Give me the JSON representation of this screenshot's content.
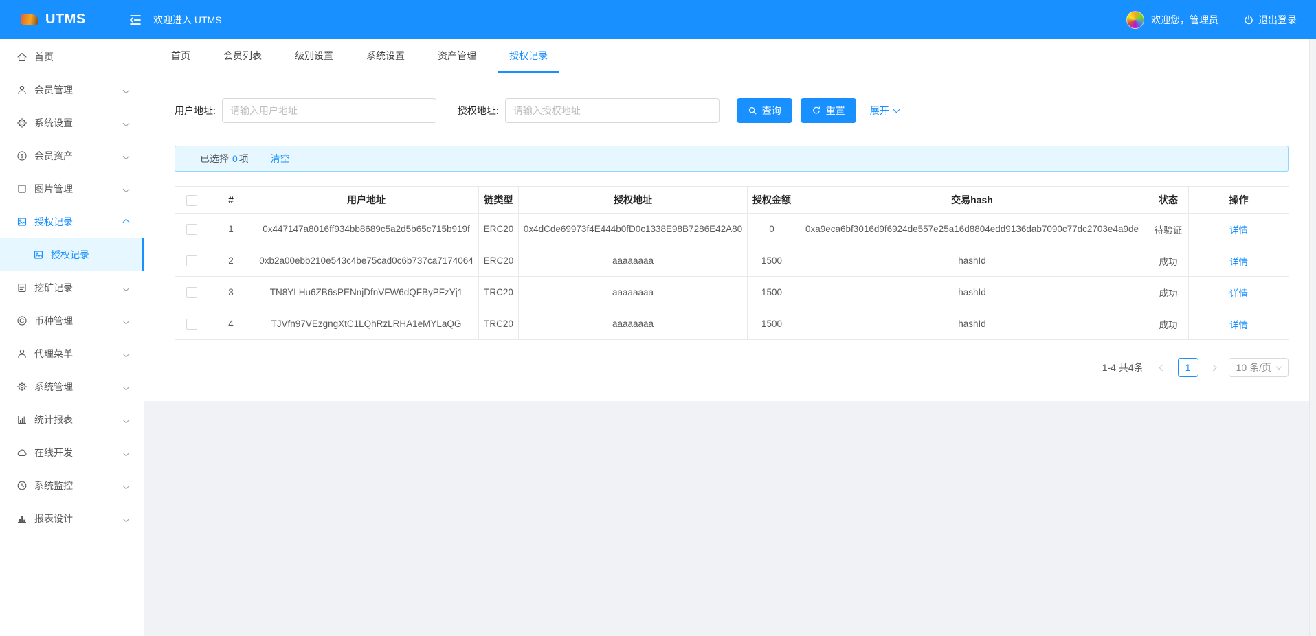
{
  "colors": {
    "accent": "#1890ff",
    "header_bg": "#1890ff",
    "alert_bg": "#e6f7ff",
    "alert_border": "#91d5ff",
    "active_menu_bg": "#e6f7ff",
    "page_bg": "#f0f2f5"
  },
  "header": {
    "brand": "UTMS",
    "welcome": "欢迎进入 UTMS",
    "user_greeting": "欢迎您，管理员",
    "logout": "退出登录"
  },
  "sidebar": {
    "items": [
      {
        "label": "首页",
        "icon": "home-icon"
      },
      {
        "label": "会员管理",
        "icon": "user-icon"
      },
      {
        "label": "系统设置",
        "icon": "gear-icon"
      },
      {
        "label": "会员资产",
        "icon": "dollar-circle-icon"
      },
      {
        "label": "图片管理",
        "icon": "square-icon"
      },
      {
        "label": "授权记录",
        "icon": "image-icon",
        "expanded": true,
        "active": true
      },
      {
        "label": "挖矿记录",
        "icon": "form-icon"
      },
      {
        "label": "币种管理",
        "icon": "copyright-icon"
      },
      {
        "label": "代理菜单",
        "icon": "user-icon"
      },
      {
        "label": "系统管理",
        "icon": "gear-icon"
      },
      {
        "label": "统计报表",
        "icon": "bar-chart-icon"
      },
      {
        "label": "在线开发",
        "icon": "cloud-icon"
      },
      {
        "label": "系统监控",
        "icon": "clock-icon"
      },
      {
        "label": "报表设计",
        "icon": "chart-icon"
      }
    ],
    "submenu": {
      "label": "授权记录",
      "icon": "image-icon"
    }
  },
  "tabs": {
    "items": [
      {
        "label": "首页"
      },
      {
        "label": "会员列表"
      },
      {
        "label": "级别设置"
      },
      {
        "label": "系统设置"
      },
      {
        "label": "资产管理"
      },
      {
        "label": "授权记录",
        "active": true
      }
    ]
  },
  "filters": {
    "user_address_label": "用户地址:",
    "user_address_placeholder": "请输入用户地址",
    "user_address_value": "",
    "auth_address_label": "授权地址:",
    "auth_address_placeholder": "请输入授权地址",
    "auth_address_value": "",
    "search_label": "查询",
    "reset_label": "重置",
    "expand_label": "展开"
  },
  "selection": {
    "prefix": "已选择",
    "count": "0",
    "suffix": "项",
    "clear_label": "清空"
  },
  "table": {
    "headers": [
      "#",
      "用户地址",
      "链类型",
      "授权地址",
      "授权金额",
      "交易hash",
      "状态",
      "操作"
    ],
    "rows": [
      {
        "index": "1",
        "user_address": "0x447147a8016ff934bb8689c5a2d5b65c715b919f",
        "chain_type": "ERC20",
        "auth_address": "0x4dCde69973f4E444b0fD0c1338E98B7286E42A80",
        "amount": "0",
        "tx_hash": "0xa9eca6bf3016d9f6924de557e25a16d8804edd9136dab7090c77dc2703e4a9de",
        "status": "待验证",
        "action": "详情"
      },
      {
        "index": "2",
        "user_address": "0xb2a00ebb210e543c4be75cad0c6b737ca7174064",
        "chain_type": "ERC20",
        "auth_address": "aaaaaaaa",
        "amount": "1500",
        "tx_hash": "hashId",
        "status": "成功",
        "action": "详情"
      },
      {
        "index": "3",
        "user_address": "TN8YLHu6ZB6sPENnjDfnVFW6dQFByPFzYj1",
        "chain_type": "TRC20",
        "auth_address": "aaaaaaaa",
        "amount": "1500",
        "tx_hash": "hashId",
        "status": "成功",
        "action": "详情"
      },
      {
        "index": "4",
        "user_address": "TJVfn97VEzgngXtC1LQhRzLRHA1eMYLaQG",
        "chain_type": "TRC20",
        "auth_address": "aaaaaaaa",
        "amount": "1500",
        "tx_hash": "hashId",
        "status": "成功",
        "action": "详情"
      }
    ]
  },
  "pagination": {
    "total": "1-4 共4条",
    "page": "1",
    "page_size": "10 条/页"
  }
}
